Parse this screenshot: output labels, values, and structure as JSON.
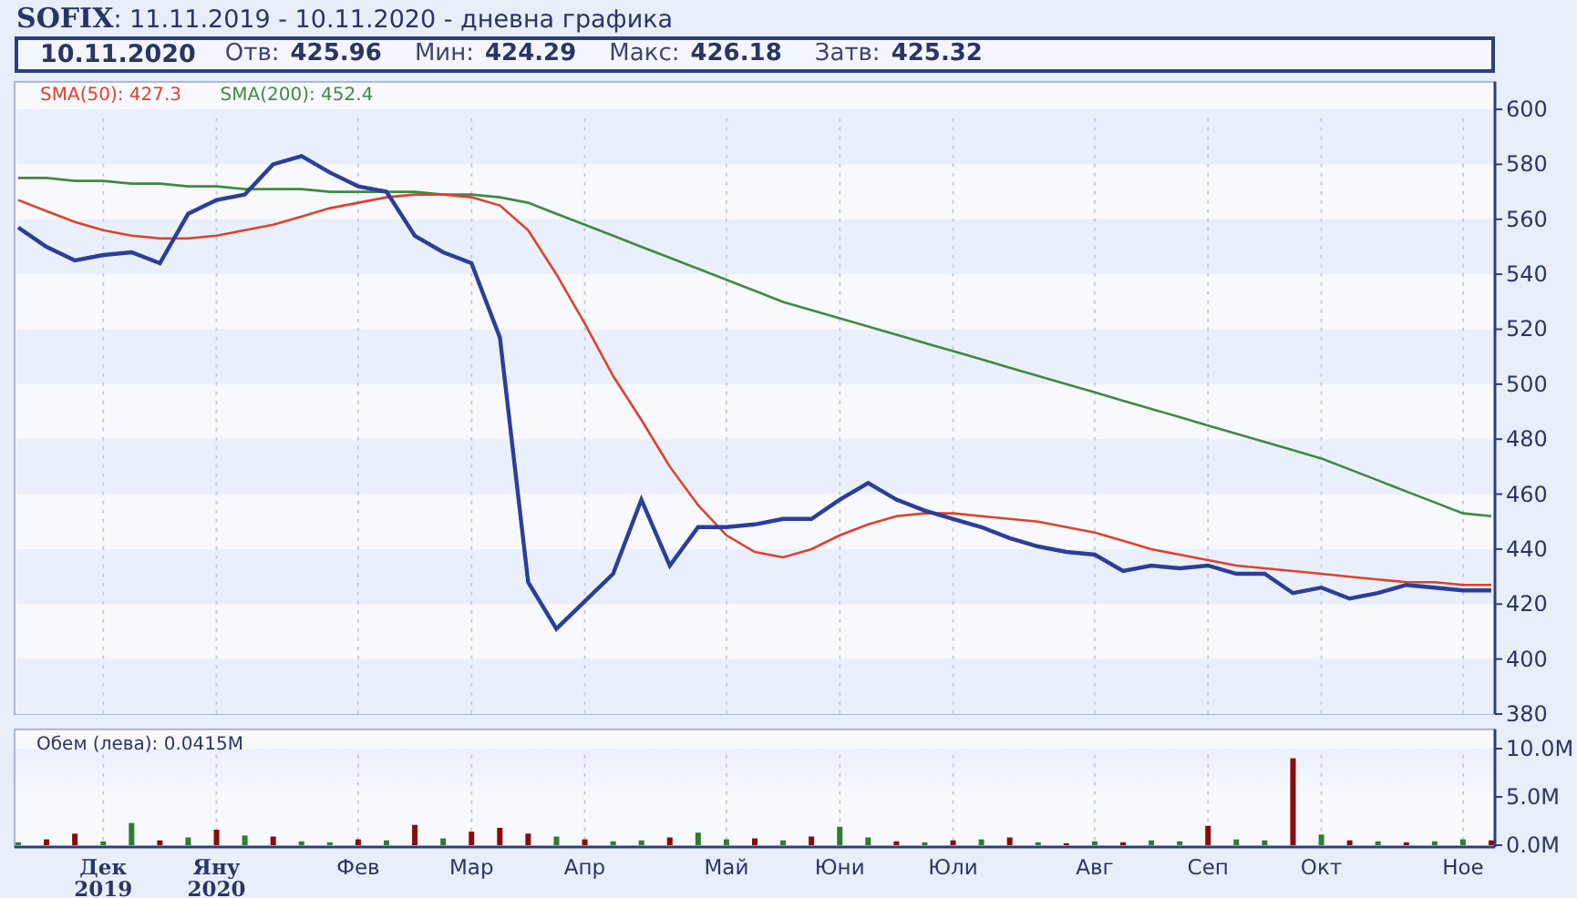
{
  "title": "**SOFIX**: 11.11.2019 - 10.11.2020 - дневна графика",
  "quote": {
    "date": "10.11.2020",
    "fields": [
      {
        "label": "Отв:",
        "value": "425.96"
      },
      {
        "label": "Мин:",
        "value": "424.29"
      },
      {
        "label": "Макс:",
        "value": "426.18"
      },
      {
        "label": "Затв:",
        "value": "425.32"
      }
    ]
  },
  "price_chart": {
    "legend": [
      {
        "text": "SMA(50): 427.3",
        "color": "#e0402a"
      },
      {
        "text": "SMA(200): 452.4",
        "color": "#3f8a3f"
      }
    ],
    "chart_data": {
      "type": "line",
      "grid": true,
      "ylim": [
        380,
        610
      ],
      "yticks": [
        380,
        400,
        420,
        440,
        460,
        480,
        500,
        520,
        540,
        560,
        580,
        600
      ],
      "series": [
        {
          "color": "#2c3e9a",
          "values": [
            557,
            550,
            545,
            547,
            548,
            544,
            562,
            567,
            569,
            580,
            583,
            577,
            572,
            570,
            554,
            548,
            544,
            517,
            428,
            411,
            421,
            431,
            458,
            434,
            448,
            448,
            449,
            451,
            451,
            458,
            464,
            458,
            454,
            451,
            448,
            444,
            441,
            439,
            438,
            432,
            434,
            433,
            434,
            431,
            431,
            424,
            426,
            422,
            424,
            427,
            426,
            425,
            425
          ]
        },
        {
          "color": "#e0402a",
          "values": [
            567,
            563,
            559,
            556,
            554,
            553,
            553,
            554,
            556,
            558,
            561,
            564,
            566,
            568,
            569,
            569,
            568,
            565,
            556,
            540,
            522,
            503,
            487,
            470,
            456,
            445,
            439,
            437,
            440,
            445,
            449,
            452,
            453,
            453,
            452,
            451,
            450,
            448,
            446,
            443,
            440,
            438,
            436,
            434,
            433,
            432,
            431,
            430,
            429,
            428,
            428,
            427,
            427
          ]
        },
        {
          "color": "#3f8a3f",
          "values": [
            575,
            575,
            574,
            574,
            573,
            573,
            572,
            572,
            571,
            571,
            571,
            570,
            570,
            570,
            570,
            569,
            569,
            568,
            566,
            562,
            558,
            554,
            550,
            546,
            542,
            538,
            534,
            530,
            527,
            524,
            521,
            518,
            515,
            512,
            509,
            506,
            503,
            500,
            497,
            494,
            491,
            488,
            485,
            482,
            479,
            476,
            473,
            469,
            465,
            461,
            457,
            453,
            452
          ]
        }
      ]
    }
  },
  "volume_chart": {
    "legend": "Обем (лева): 0.0415M",
    "chart_data": {
      "type": "bar",
      "grid": true,
      "ylim": [
        0,
        12
      ],
      "categories": [
        null,
        null,
        null,
        "Дек",
        null,
        null,
        null,
        "Яну",
        null,
        null,
        null,
        null,
        "Фев",
        null,
        null,
        null,
        "Мар",
        null,
        null,
        null,
        "Апр",
        null,
        null,
        null,
        null,
        "Май",
        null,
        null,
        null,
        "Юни",
        null,
        null,
        null,
        "Юли",
        null,
        null,
        null,
        null,
        "Авг",
        null,
        null,
        null,
        "Сеп",
        null,
        null,
        null,
        "Окт",
        null,
        null,
        null,
        null,
        "Ное",
        null
      ],
      "yticks": [
        {
          "value": 0,
          "label": "0.0M"
        },
        {
          "value": 5,
          "label": "5.0M"
        },
        {
          "value": 10,
          "label": "10.0M"
        }
      ],
      "series": [
        {
          "color": "#2e7d32",
          "values": [
            0.3,
            null,
            null,
            0.4,
            2.3,
            null,
            0.8,
            null,
            1.0,
            null,
            0.4,
            0.3,
            null,
            0.5,
            null,
            0.7,
            null,
            null,
            null,
            0.9,
            null,
            0.4,
            0.5,
            null,
            1.3,
            0.6,
            null,
            0.5,
            null,
            1.9,
            0.8,
            null,
            0.3,
            null,
            0.6,
            null,
            0.3,
            null,
            0.4,
            null,
            0.5,
            0.4,
            null,
            0.6,
            0.5,
            null,
            1.1,
            null,
            0.4,
            null,
            0.4,
            0.6,
            null
          ]
        },
        {
          "color": "#8b0a0a",
          "values": [
            null,
            0.6,
            1.2,
            null,
            null,
            0.5,
            null,
            1.6,
            null,
            0.9,
            null,
            null,
            0.6,
            null,
            2.1,
            null,
            1.4,
            1.8,
            1.2,
            null,
            0.6,
            null,
            null,
            0.8,
            null,
            null,
            0.7,
            null,
            0.9,
            null,
            null,
            0.4,
            null,
            0.5,
            null,
            0.8,
            null,
            0.2,
            null,
            0.3,
            null,
            null,
            2.0,
            null,
            null,
            9.0,
            null,
            0.5,
            null,
            0.3,
            null,
            null,
            0.5
          ]
        }
      ]
    }
  },
  "x_axis": {
    "years": [
      "2019",
      "2020"
    ]
  }
}
